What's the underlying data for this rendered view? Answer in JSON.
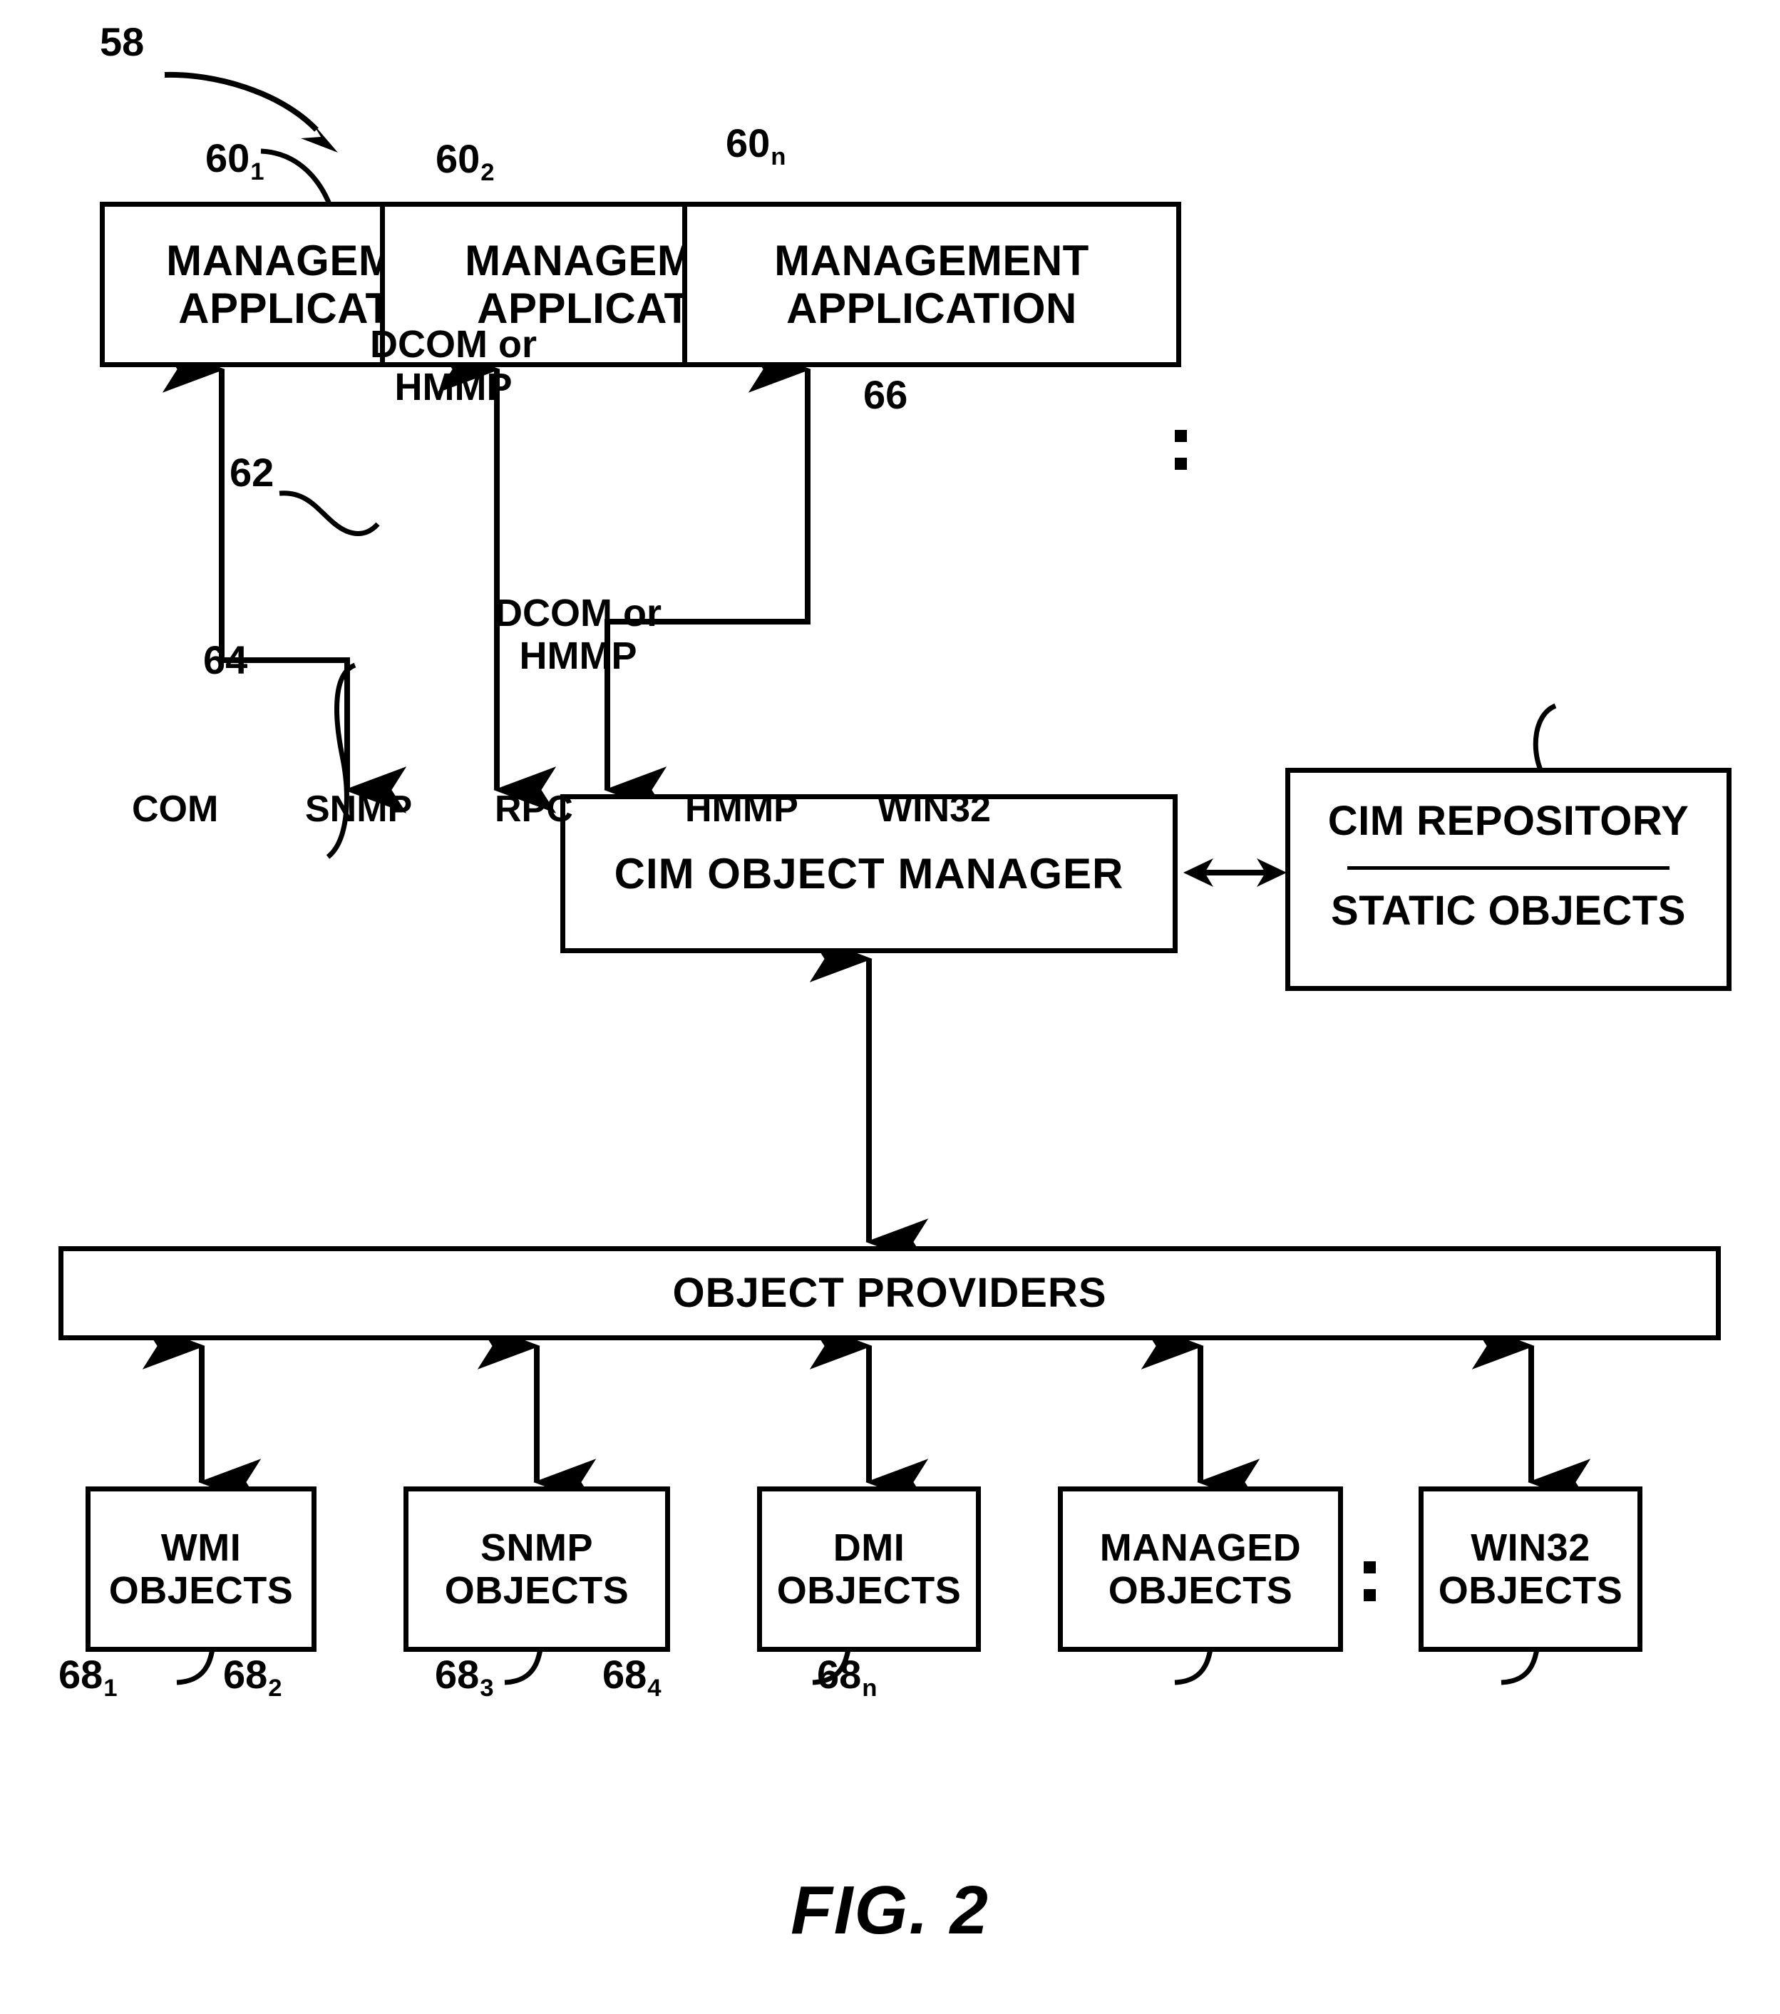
{
  "figure": {
    "caption": "FIG. 2",
    "system_ref": "58"
  },
  "management_applications": [
    {
      "ref_base": "60",
      "ref_sub": "1",
      "line1": "MANAGEMENT",
      "line2": "APPLICATION"
    },
    {
      "ref_base": "60",
      "ref_sub": "2",
      "line1": "MANAGEMENT",
      "line2": "APPLICATION"
    },
    {
      "ref_base": "60",
      "ref_sub": "n",
      "line1": "MANAGEMENT",
      "line2": "APPLICATION"
    }
  ],
  "cim_object_manager": {
    "ref": "62",
    "label": "CIM OBJECT MANAGER"
  },
  "cim_repository": {
    "ref": "66",
    "line1": "CIM REPOSITORY",
    "line2": "STATIC OBJECTS"
  },
  "object_providers": {
    "ref": "64",
    "label": "OBJECT PROVIDERS"
  },
  "connector_labels": {
    "apps_to_com": "DCOM or\nHMMP",
    "apps_to_com_line1": "DCOM or",
    "apps_to_com_line2": "HMMP",
    "com_to_providers_line1": "DCOM or",
    "com_to_providers_line2": "HMMP",
    "wmi": "COM",
    "snmp": "SNMP",
    "dmi": "RPC",
    "managed": "HMMP",
    "win32": "WIN32"
  },
  "object_sources": [
    {
      "ref_base": "68",
      "ref_sub": "1",
      "line1": "WMI",
      "line2": "OBJECTS",
      "protocol": "COM"
    },
    {
      "ref_base": "68",
      "ref_sub": "2",
      "line1": "SNMP",
      "line2": "OBJECTS",
      "protocol": "SNMP"
    },
    {
      "ref_base": "68",
      "ref_sub": "3",
      "line1": "DMI",
      "line2": "OBJECTS",
      "protocol": "RPC"
    },
    {
      "ref_base": "68",
      "ref_sub": "4",
      "line1": "MANAGED",
      "line2": "OBJECTS",
      "protocol": "HMMP"
    },
    {
      "ref_base": "68",
      "ref_sub": "n",
      "line1": "WIN32",
      "line2": "OBJECTS",
      "protocol": "WIN32"
    }
  ],
  "ellipsis": {
    "glyph": "vertical-two-dots"
  },
  "colors": {
    "ink": "#000000",
    "paper": "#ffffff"
  }
}
